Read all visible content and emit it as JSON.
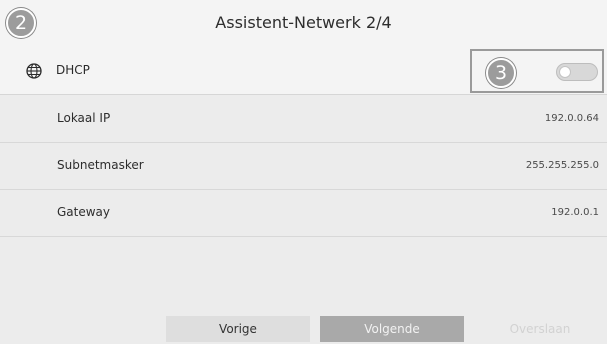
{
  "header": {
    "step_badge": "2",
    "title": "Assistent-Netwerk 2/4"
  },
  "dhcp": {
    "icon": "globe-icon",
    "label": "DHCP",
    "step_badge": "3",
    "toggle_state": "off"
  },
  "rows": [
    {
      "label": "Lokaal IP",
      "value": "192.0.0.64"
    },
    {
      "label": "Subnetmasker",
      "value": "255.255.255.0"
    },
    {
      "label": "Gateway",
      "value": "192.0.0.1"
    }
  ],
  "footer": {
    "prev_label": "Vorige",
    "next_label": "Volgende",
    "skip_label": "Overslaan"
  },
  "colors": {
    "background": "#ececec",
    "next_button": "#a9a9a9",
    "prev_button": "#dedede"
  }
}
